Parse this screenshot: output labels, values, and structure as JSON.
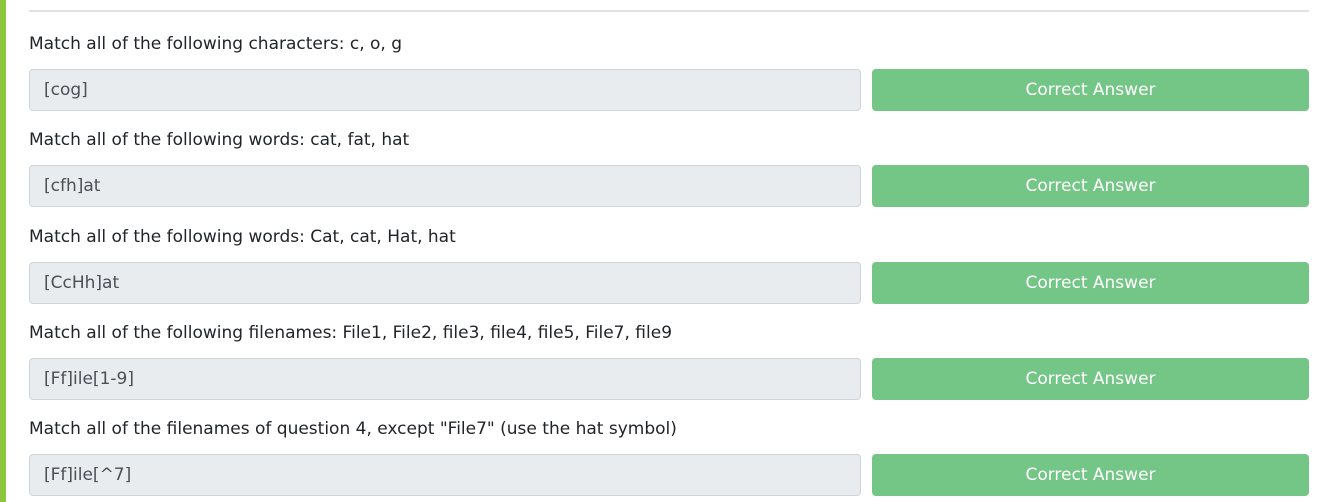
{
  "colors": {
    "accent": "#8cc63f",
    "button": "#74c687"
  },
  "questions": [
    {
      "prompt": "Match all of the following characters: c, o, g",
      "answer": "[cog]",
      "button_label": "Correct Answer"
    },
    {
      "prompt": "Match all of the following words: cat, fat, hat",
      "answer": "[cfh]at",
      "button_label": "Correct Answer"
    },
    {
      "prompt": "Match all of the following words: Cat, cat, Hat, hat",
      "answer": "[CcHh]at",
      "button_label": "Correct Answer"
    },
    {
      "prompt": "Match all of the following filenames: File1, File2, file3, file4, file5, File7, file9",
      "answer": "[Ff]ile[1-9]",
      "button_label": "Correct Answer"
    },
    {
      "prompt": "Match all of the filenames of question 4, except \"File7\" (use the hat symbol)",
      "answer": "[Ff]ile[^7]",
      "button_label": "Correct Answer"
    }
  ]
}
